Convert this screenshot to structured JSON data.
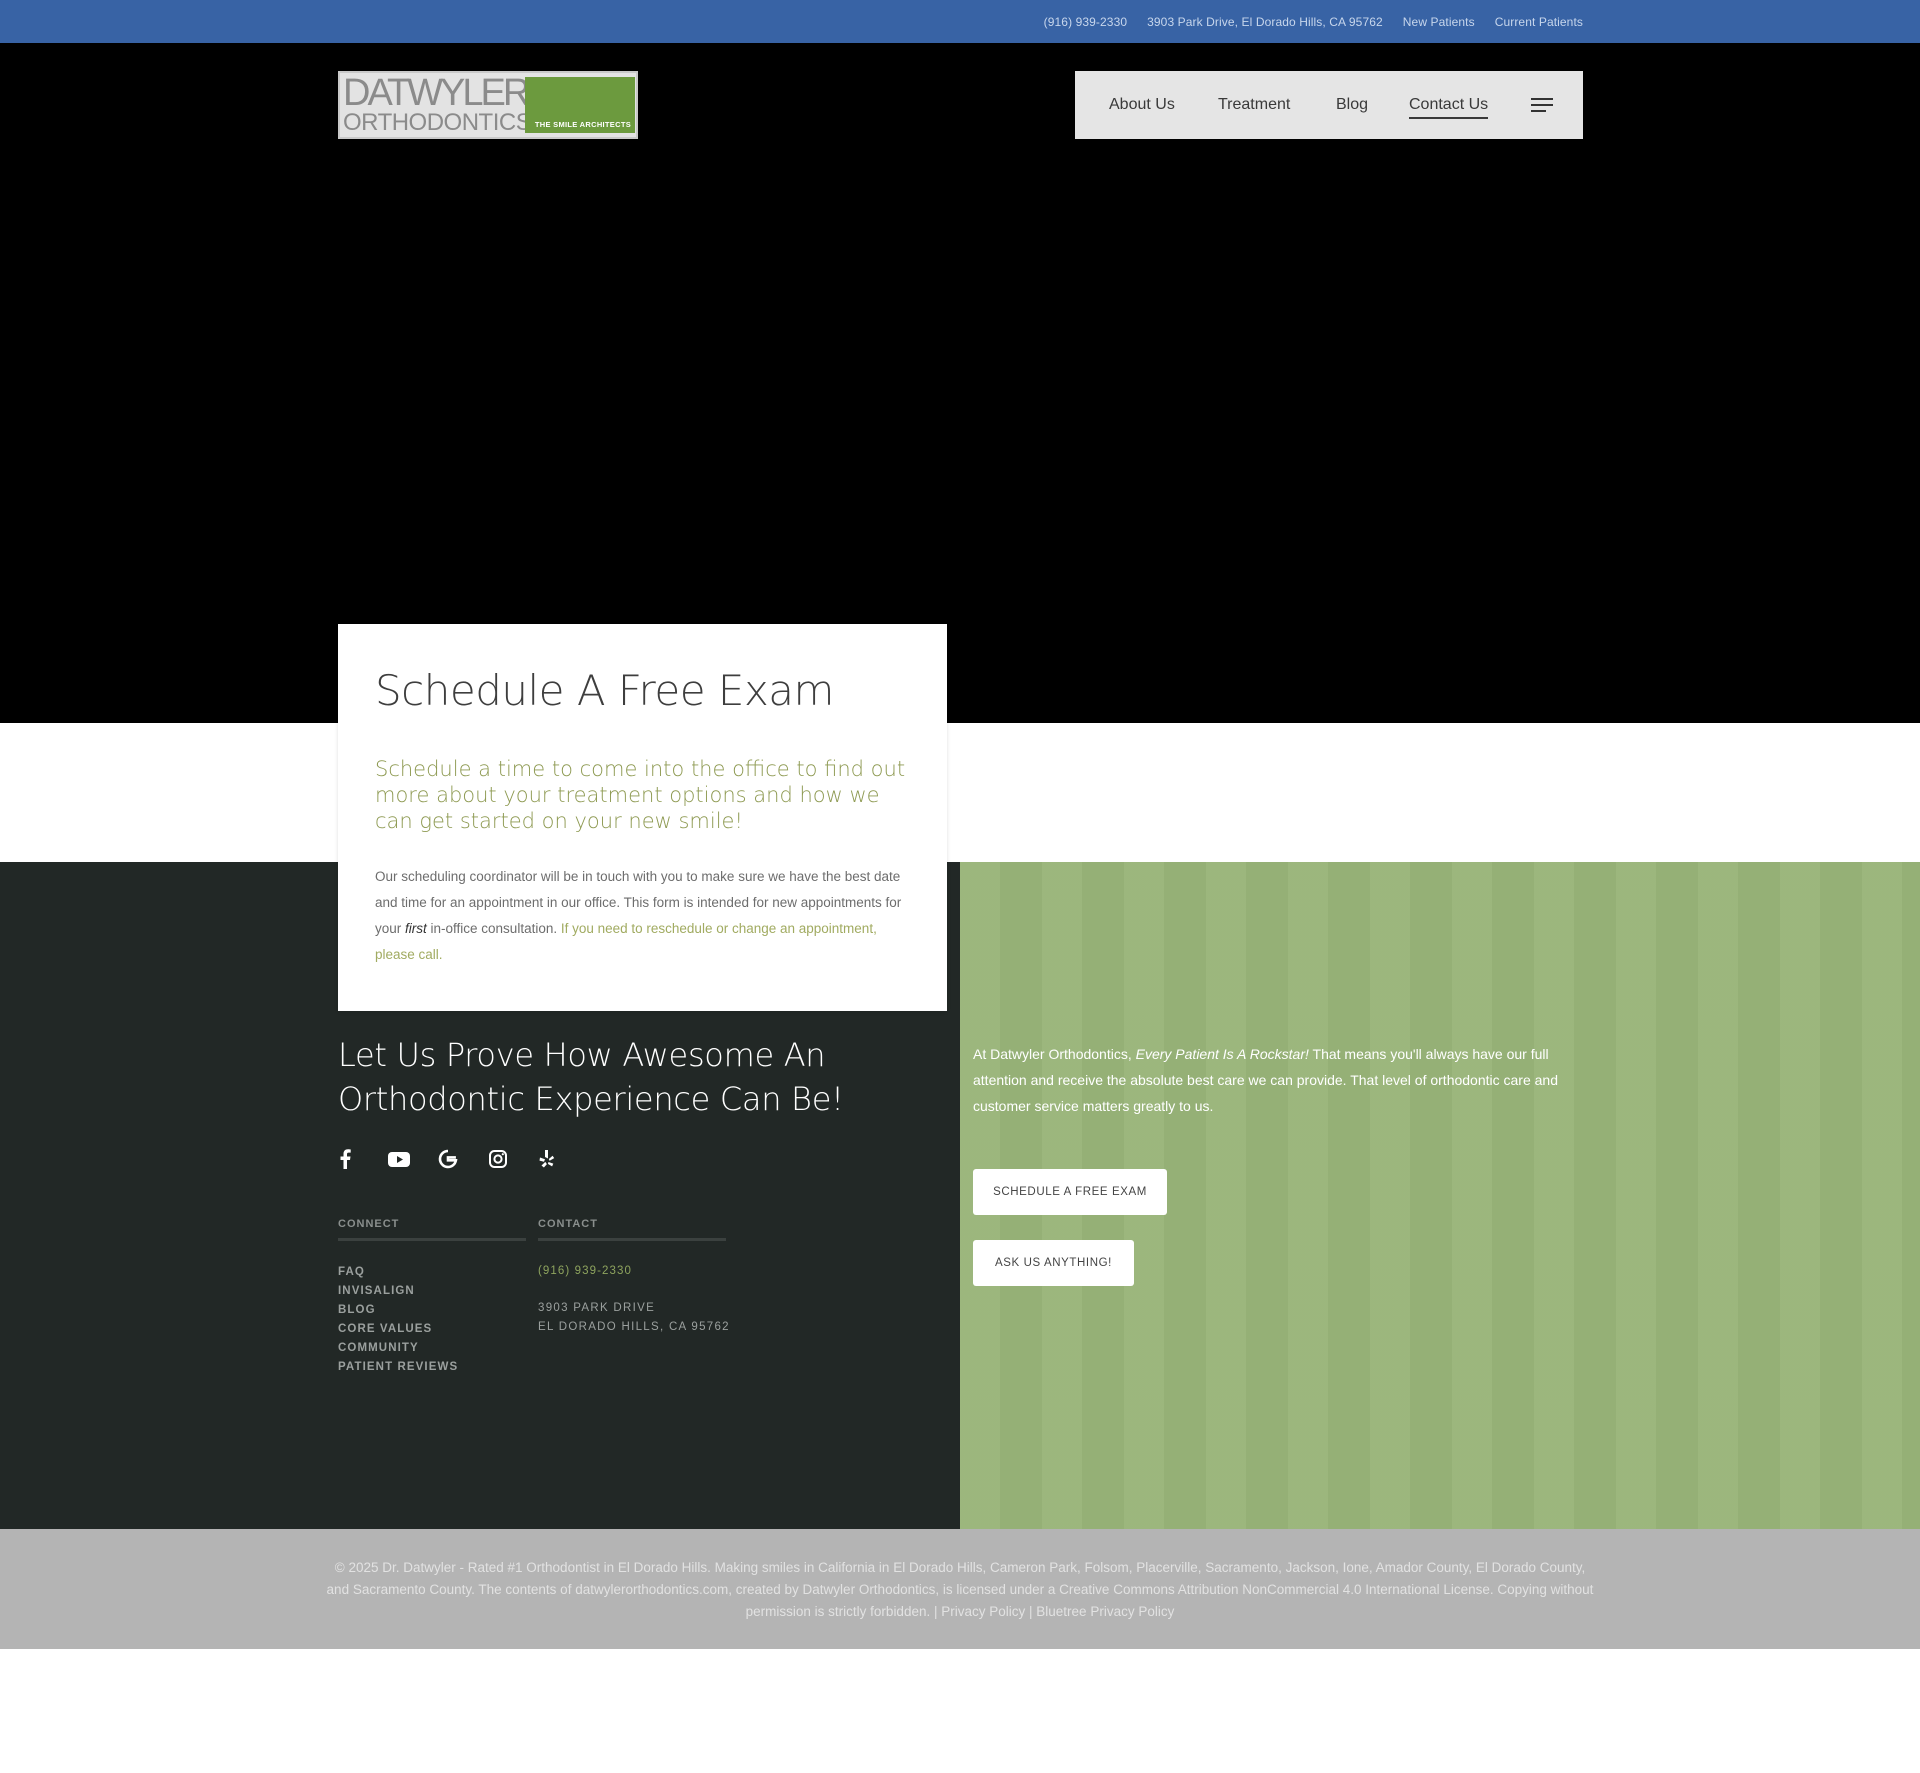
{
  "topbar": {
    "phone": "(916) 939-2330",
    "address": "3903 Park Drive, El Dorado Hills, CA 95762",
    "new_patients": "New Patients",
    "current_patients": "Current Patients"
  },
  "logo": {
    "line1": "DATWYLER",
    "line2": "ORTHODONTICS",
    "tagline": "THE SMILE ARCHITECTS"
  },
  "nav": {
    "items": [
      {
        "label": "About Us"
      },
      {
        "label": "Treatment"
      },
      {
        "label": "Blog"
      },
      {
        "label": "Contact Us"
      }
    ],
    "menu_icon": "hamburger-icon"
  },
  "card": {
    "title": "Schedule A Free Exam",
    "lead": "Schedule a time to come into the office to find out more about your treatment options and how we can get started on your new smile!",
    "body_part1": "Our scheduling coordinator will be in touch with you to make sure we have the best date and time for an appointment in our office. This form is intended for new appointments for your ",
    "body_em": "first",
    "body_part2": " in-office consultation. ",
    "body_green": "If you need to reschedule or change an appointment, please call."
  },
  "footer": {
    "heading": "Let Us Prove How Awesome An Orthodontic Experience Can Be!",
    "socials": [
      "facebook-icon",
      "youtube-icon",
      "google-icon",
      "instagram-icon",
      "yelp-icon"
    ],
    "connect": {
      "title": "CONNECT",
      "links": [
        "FAQ",
        "INVISALIGN",
        "BLOG",
        "CORE VALUES",
        "COMMUNITY",
        "PATIENT REVIEWS"
      ]
    },
    "contact": {
      "title": "CONTACT",
      "phone": "(916) 939-2330",
      "address_line1": "3903 PARK DRIVE",
      "address_line2": "EL DORADO HILLS, CA 95762"
    },
    "green": {
      "text_part1": "At Datwyler Orthodontics, ",
      "text_em": "Every Patient Is A Rockstar!",
      "text_part2": " That means you'll always have our full attention and receive the absolute best care we can provide. That level of orthodontic care and customer service matters greatly to us.",
      "button1": "SCHEDULE A FREE EXAM",
      "button2": "ASK US ANYTHING!"
    }
  },
  "copyright": {
    "text": "© 2025 Dr. Datwyler - Rated #1 Orthodontist in El Dorado Hills. Making smiles in California in El Dorado Hills, Cameron Park, Folsom, Placerville, Sacramento, Jackson, Ione, Amador County, El Dorado County, and Sacramento County. The contents of datwylerorthodontics.com, created by Datwyler Orthodontics, is licensed under a Creative Commons Attribution NonCommercial 4.0 International License. Copying without permission is strictly forbidden. | ",
    "privacy": "Privacy Policy",
    "separator": " | ",
    "bluetree_privacy": "Bluetree Privacy Policy"
  },
  "colors": {
    "topbar": "#3863a5",
    "hero": "#000000",
    "dark_panel": "#222826",
    "green_panel": "#98b478",
    "accent_green": "#8e9a52",
    "copyright_bg": "#b4b4b4"
  }
}
